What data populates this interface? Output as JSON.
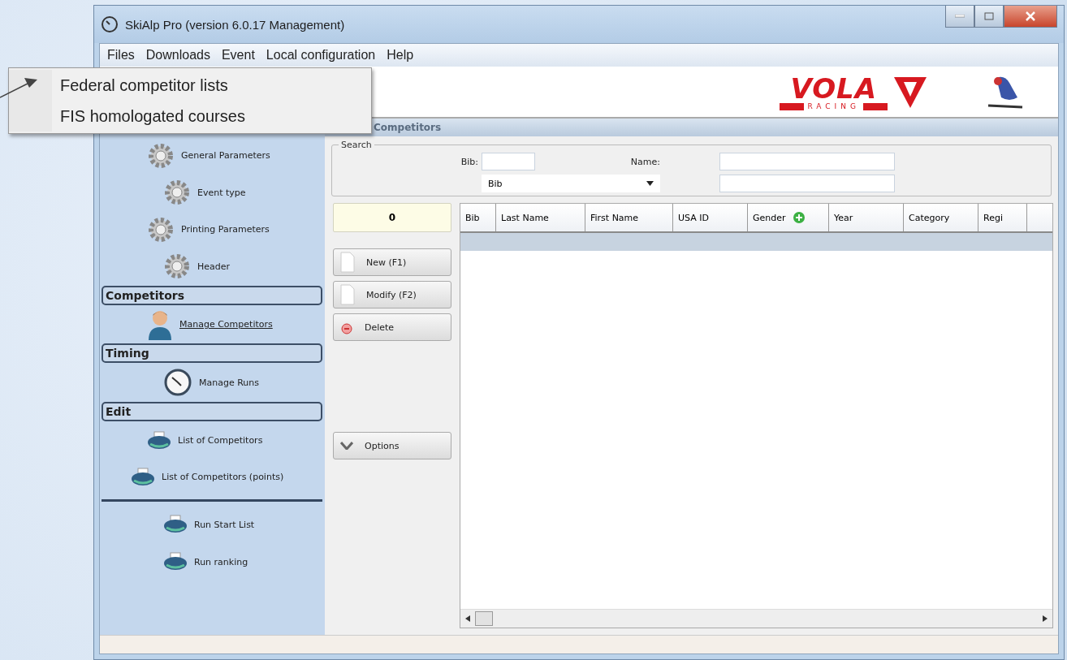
{
  "window": {
    "title": "SkiAlp Pro (version 6.0.17 Management)"
  },
  "menu_bar": [
    "Files",
    "Downloads",
    "Event",
    "Local configuration",
    "Help"
  ],
  "popup_menu": [
    "Federal competitor lists",
    "FIS homologated courses"
  ],
  "banner": {
    "logo_text": "VOLA",
    "logo_subtext": "RACING"
  },
  "sidebar": [
    {
      "kind": "gear",
      "label": "General Parameters",
      "link": false
    },
    {
      "kind": "gear",
      "label": "Event type",
      "link": false
    },
    {
      "kind": "gear",
      "label": "Printing Parameters",
      "link": false
    },
    {
      "kind": "gear",
      "label": "Header",
      "link": false
    },
    {
      "kind": "section",
      "label": "Competitors"
    },
    {
      "kind": "person",
      "label": "Manage Competitors",
      "link": true
    },
    {
      "kind": "section",
      "label": "Timing"
    },
    {
      "kind": "clock",
      "label": "Manage Runs",
      "link": false
    },
    {
      "kind": "section",
      "label": "Edit"
    },
    {
      "kind": "printer",
      "label": "List of Competitors",
      "link": false
    },
    {
      "kind": "printer",
      "label": "List of Competitors (points)",
      "link": false
    },
    {
      "kind": "separator"
    },
    {
      "kind": "printer",
      "label": "Run Start List",
      "link": false
    },
    {
      "kind": "printer",
      "label": "Run ranking",
      "link": false
    }
  ],
  "panel": {
    "title": "Competitors"
  },
  "search": {
    "title": "Search",
    "bib_label": "Bib:",
    "name_label": "Name:",
    "sort_value": "Bib"
  },
  "counter": "0",
  "buttons": [
    {
      "kind": "doc",
      "label": "New (F1)"
    },
    {
      "kind": "doc",
      "label": "Modify (F2)"
    },
    {
      "kind": "delete",
      "label": "Delete"
    }
  ],
  "options_button": "Options",
  "table": {
    "columns": [
      "Bib",
      "Last Name",
      "First Name",
      "USA ID",
      "Gender",
      "Year",
      "Category",
      "Regi"
    ]
  }
}
